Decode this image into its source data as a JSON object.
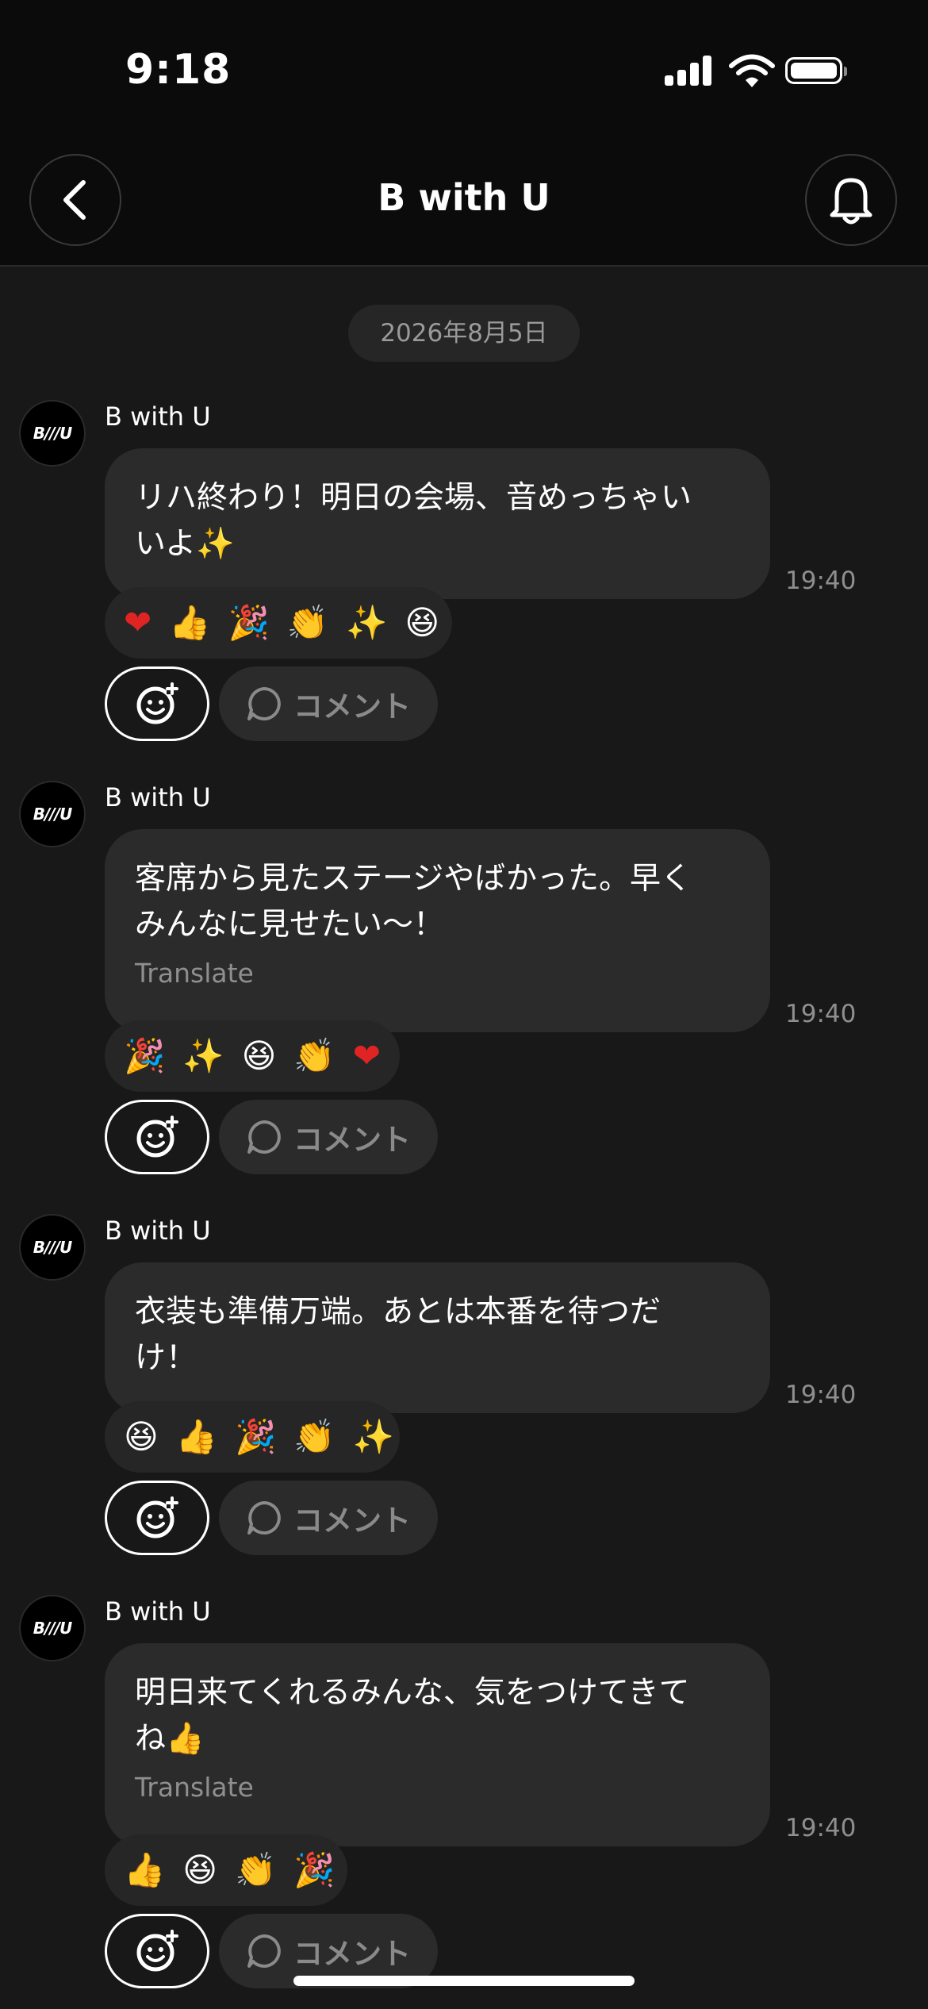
{
  "status_bar": {
    "time": "9:18"
  },
  "header": {
    "title": "B with U"
  },
  "date_separator": "2026年8月5日",
  "avatar_text": "B///U",
  "colors": {
    "background": "#181818",
    "bubble": "#2b2b2b",
    "header": "#0b0b0b"
  },
  "messages": [
    {
      "sender": "B with U",
      "text": "リハ終わり！明日の会場、音めっちゃい\nいよ✨",
      "translate": "",
      "time": "19:40",
      "reactions": [
        "❤",
        "👍",
        "🎉",
        "👏",
        "✨",
        "😆"
      ],
      "comment_label": "コメント"
    },
    {
      "sender": "B with U",
      "text": "客席から見たステージやばかった。早く\nみんなに見せたい〜！",
      "translate": "Translate",
      "time": "19:40",
      "reactions": [
        "🎉",
        "✨",
        "😆",
        "👏",
        "❤"
      ],
      "comment_label": "コメント"
    },
    {
      "sender": "B with U",
      "text": "衣装も準備万端。あとは本番を待つだ\nけ！",
      "translate": "",
      "time": "19:40",
      "reactions": [
        "😆",
        "👍",
        "🎉",
        "👏",
        "✨"
      ],
      "comment_label": "コメント"
    },
    {
      "sender": "B with U",
      "text": "明日来てくれるみんな、気をつけてきて\nね👍",
      "translate": "Translate",
      "time": "19:40",
      "reactions": [
        "👍",
        "😆",
        "👏",
        "🎉"
      ],
      "comment_label": "コメント"
    }
  ]
}
